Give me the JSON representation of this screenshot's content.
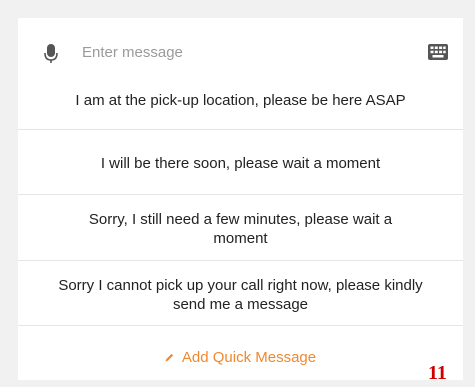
{
  "input": {
    "placeholder": "Enter message",
    "left_icon": "microphone-icon",
    "right_icon": "keyboard-icon"
  },
  "quick_messages": [
    "I am at the pick-up location, please be here ASAP",
    "I will be there soon, please wait a moment",
    "Sorry, I still need a few minutes, please wait a moment",
    "Sorry I cannot pick up your call right now, please kindly send me a message"
  ],
  "add_action": {
    "label": "Add Quick Message",
    "icon": "pencil-icon"
  },
  "page_number": "11",
  "colors": {
    "accent": "#f0882f",
    "page_number": "#cc0000",
    "placeholder": "#9a9a9a",
    "icon": "#555555"
  }
}
